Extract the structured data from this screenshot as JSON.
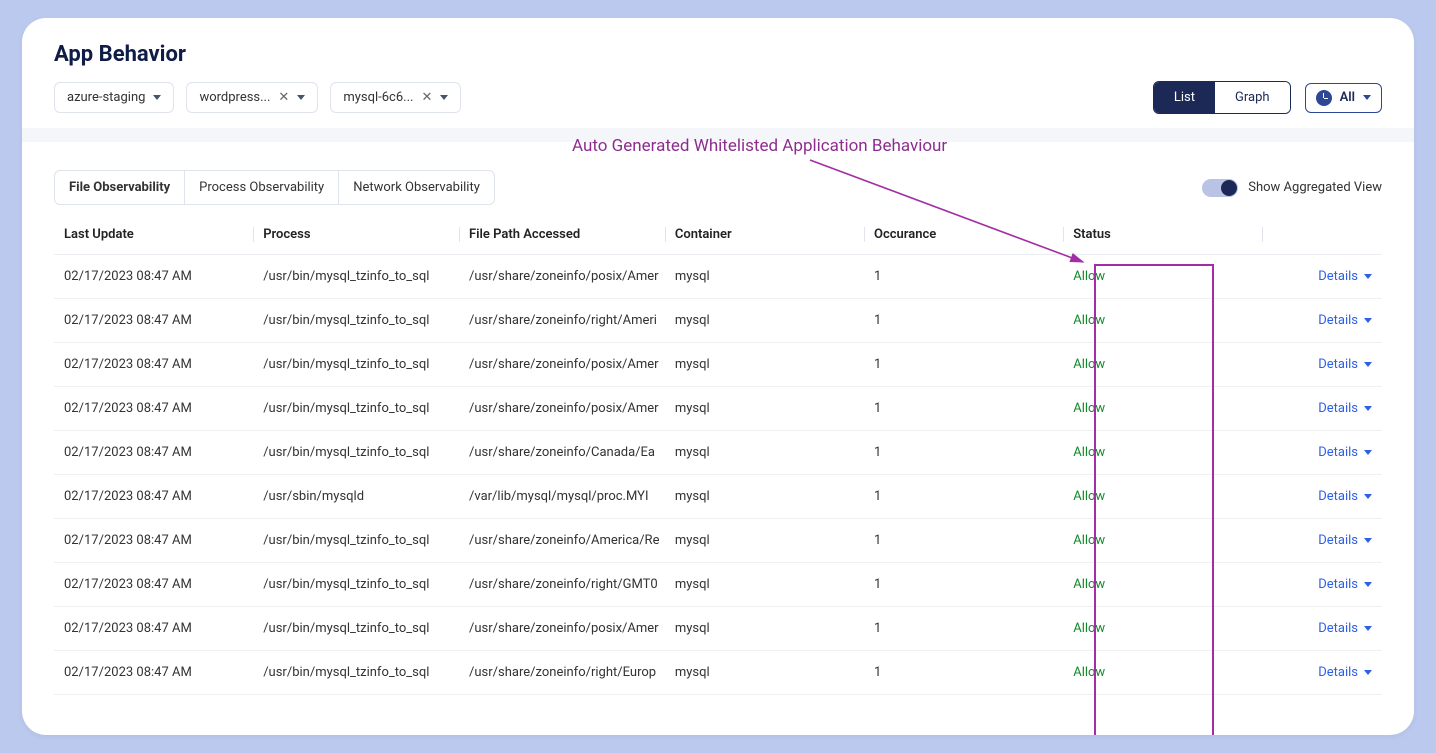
{
  "title": "App Behavior",
  "filters": {
    "env": "azure-staging",
    "app": "wordpress...",
    "db": "mysql-6c6..."
  },
  "view": {
    "list": "List",
    "graph": "Graph",
    "all": "All"
  },
  "annotation": "Auto Generated Whitelisted Application Behaviour",
  "tabs": {
    "file": "File Observability",
    "process": "Process Observability",
    "network": "Network Observability"
  },
  "toggle": "Show Aggregated View",
  "cols": {
    "last": "Last Update",
    "proc": "Process",
    "file": "File Path Accessed",
    "cont": "Container",
    "occ": "Occurance",
    "stat": "Status"
  },
  "detailsLabel": "Details",
  "rows": [
    {
      "last": "02/17/2023 08:47 AM",
      "proc": "/usr/bin/mysql_tzinfo_to_sql",
      "file": "/usr/share/zoneinfo/posix/Amer",
      "cont": "mysql",
      "occ": "1",
      "stat": "Allow"
    },
    {
      "last": "02/17/2023 08:47 AM",
      "proc": "/usr/bin/mysql_tzinfo_to_sql",
      "file": "/usr/share/zoneinfo/right/Ameri",
      "cont": "mysql",
      "occ": "1",
      "stat": "Allow"
    },
    {
      "last": "02/17/2023 08:47 AM",
      "proc": "/usr/bin/mysql_tzinfo_to_sql",
      "file": "/usr/share/zoneinfo/posix/Amer",
      "cont": "mysql",
      "occ": "1",
      "stat": "Allow"
    },
    {
      "last": "02/17/2023 08:47 AM",
      "proc": "/usr/bin/mysql_tzinfo_to_sql",
      "file": "/usr/share/zoneinfo/posix/Amer",
      "cont": "mysql",
      "occ": "1",
      "stat": "Allow"
    },
    {
      "last": "02/17/2023 08:47 AM",
      "proc": "/usr/bin/mysql_tzinfo_to_sql",
      "file": "/usr/share/zoneinfo/Canada/Ea",
      "cont": "mysql",
      "occ": "1",
      "stat": "Allow"
    },
    {
      "last": "02/17/2023 08:47 AM",
      "proc": "/usr/sbin/mysqld",
      "file": "/var/lib/mysql/mysql/proc.MYI",
      "cont": "mysql",
      "occ": "1",
      "stat": "Allow"
    },
    {
      "last": "02/17/2023 08:47 AM",
      "proc": "/usr/bin/mysql_tzinfo_to_sql",
      "file": "/usr/share/zoneinfo/America/Re",
      "cont": "mysql",
      "occ": "1",
      "stat": "Allow"
    },
    {
      "last": "02/17/2023 08:47 AM",
      "proc": "/usr/bin/mysql_tzinfo_to_sql",
      "file": "/usr/share/zoneinfo/right/GMT0",
      "cont": "mysql",
      "occ": "1",
      "stat": "Allow"
    },
    {
      "last": "02/17/2023 08:47 AM",
      "proc": "/usr/bin/mysql_tzinfo_to_sql",
      "file": "/usr/share/zoneinfo/posix/Amer",
      "cont": "mysql",
      "occ": "1",
      "stat": "Allow"
    },
    {
      "last": "02/17/2023 08:47 AM",
      "proc": "/usr/bin/mysql_tzinfo_to_sql",
      "file": "/usr/share/zoneinfo/right/Europ",
      "cont": "mysql",
      "occ": "1",
      "stat": "Allow"
    }
  ]
}
